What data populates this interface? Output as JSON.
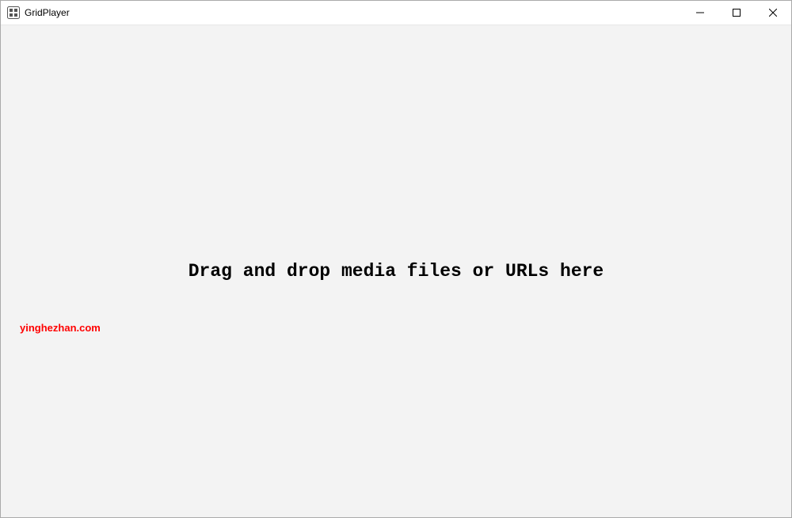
{
  "window": {
    "title": "GridPlayer"
  },
  "main": {
    "drop_message": "Drag and drop media files or URLs here"
  },
  "watermark": {
    "text": "yinghezhan.com"
  }
}
